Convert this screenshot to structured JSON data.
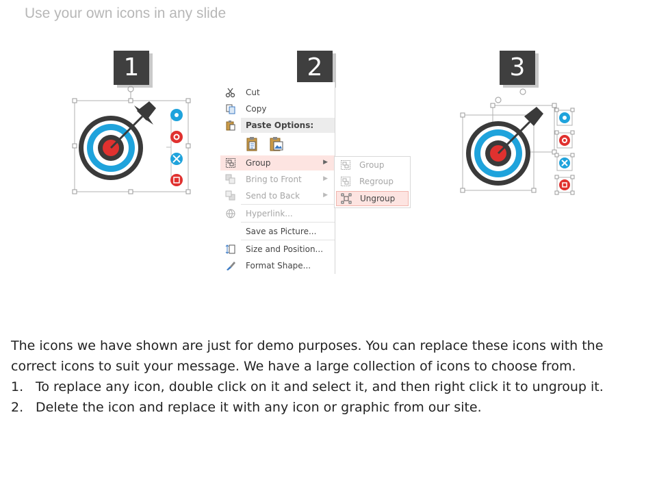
{
  "slide": {
    "title": "Use your own icons in any slide"
  },
  "steps": [
    "1",
    "2",
    "3"
  ],
  "context_menu": {
    "cut": "Cut",
    "copy": "Copy",
    "paste_options": "Paste Options:",
    "group": "Group",
    "bring_to_front": "Bring to Front",
    "send_to_back": "Send to Back",
    "hyperlink": "Hyperlink...",
    "save_as_picture": "Save as Picture...",
    "size_and_position": "Size and Position...",
    "format_shape": "Format Shape..."
  },
  "submenu": {
    "group": "Group",
    "regroup": "Regroup",
    "ungroup": "Ungroup"
  },
  "description": {
    "intro": "The icons we have shown are just for demo purposes. You can replace these icons with the correct icons to suit your message. We have a large collection of icons to choose from.",
    "steps": [
      {
        "num": "1.",
        "text": "To replace any icon, double click on it and select it, and then right click it to ungroup it."
      },
      {
        "num": "2.",
        "text": "Delete the icon and replace it with any icon or graphic from our site."
      }
    ]
  },
  "colors": {
    "ring_dark": "#3a3a3a",
    "ring_blue": "#1fa3dc",
    "bullseye_red": "#e0312f",
    "badge": "#3f3f3f",
    "highlight": "#fde4e1"
  },
  "icons": [
    "settings-icon",
    "gear-icon",
    "tools-icon",
    "clipboard-icon"
  ]
}
